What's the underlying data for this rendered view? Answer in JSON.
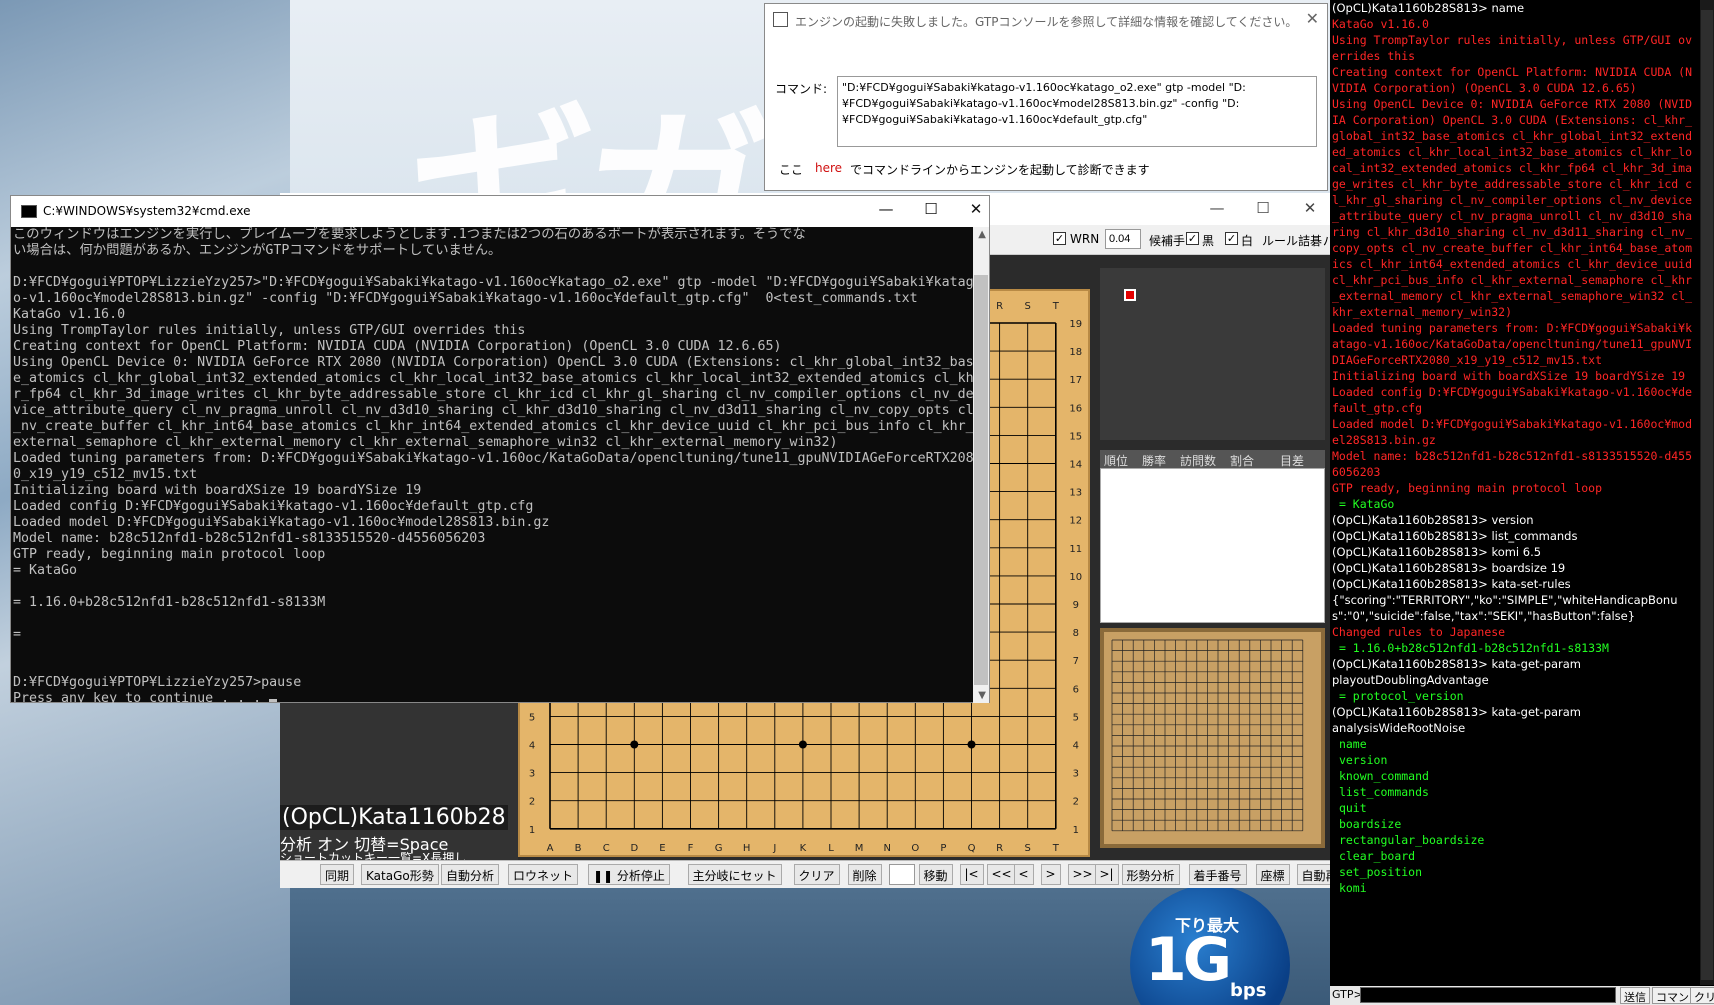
{
  "desktop": {
    "banner_text": "ギガ",
    "ad_small": "下り最大",
    "ad_big": "1G",
    "ad_unit": "bps"
  },
  "dialog": {
    "title": "エンジンの起動に失敗しました。GTPコンソールを参照して詳細な情報を確認してください。",
    "command_label": "コマンド:",
    "command_text": "\"D:¥FCD¥gogui¥Sabaki¥katago-v1.160oc¥katago_o2.exe\" gtp -model \"D:¥FCD¥gogui¥Sabaki¥katago-v1.160oc¥model28S813.bin.gz\" -config \"D:¥FCD¥gogui¥Sabaki¥katago-v1.160oc¥default_gtp.cfg\"",
    "footer_prefix": "ここ",
    "footer_link": "here",
    "footer_suffix": "でコマンドラインからエンジンを起動して診断できます"
  },
  "cmd": {
    "title": "C:¥WINDOWS¥system32¥cmd.exe",
    "lines": [
      "このウィンドウはエンジンを実行し、プレイムーブを要求しようとします.1つまたは2つの石のあるボートが表示されます。そうでな",
      "い場合は、何か問題があるか、エンジンがGTPコマンドをサポートしていません。",
      "",
      "D:¥FCD¥gogui¥PTOP¥LizzieYzy257>\"D:¥FCD¥gogui¥Sabaki¥katago-v1.160oc¥katago_o2.exe\" gtp -model \"D:¥FCD¥gogui¥Sabaki¥katag",
      "o-v1.160oc¥model28S813.bin.gz\" -config \"D:¥FCD¥gogui¥Sabaki¥katago-v1.160oc¥default_gtp.cfg\"  0<test_commands.txt",
      "KataGo v1.16.0",
      "Using TrompTaylor rules initially, unless GTP/GUI overrides this",
      "Creating context for OpenCL Platform: NVIDIA CUDA (NVIDIA Corporation) (OpenCL 3.0 CUDA 12.6.65)",
      "Using OpenCL Device 0: NVIDIA GeForce RTX 2080 (NVIDIA Corporation) OpenCL 3.0 CUDA (Extensions: cl_khr_global_int32_bas",
      "e_atomics cl_khr_global_int32_extended_atomics cl_khr_local_int32_base_atomics cl_khr_local_int32_extended_atomics cl_kh",
      "r_fp64 cl_khr_3d_image_writes cl_khr_byte_addressable_store cl_khr_icd cl_khr_gl_sharing cl_nv_compiler_options cl_nv_de",
      "vice_attribute_query cl_nv_pragma_unroll cl_nv_d3d10_sharing cl_khr_d3d10_sharing cl_nv_d3d11_sharing cl_nv_copy_opts cl",
      "_nv_create_buffer cl_khr_int64_base_atomics cl_khr_int64_extended_atomics cl_khr_device_uuid cl_khr_pci_bus_info cl_khr_",
      "external_semaphore cl_khr_external_memory cl_khr_external_semaphore_win32 cl_khr_external_memory_win32)",
      "Loaded tuning parameters from: D:¥FCD¥gogui¥Sabaki¥katago-v1.160oc/KataGoData/opencltuning/tune11_gpuNVIDIAGeForceRTX208",
      "0_x19_y19_c512_mv15.txt",
      "Initializing board with boardXSize 19 boardYSize 19",
      "Loaded config D:¥FCD¥gogui¥Sabaki¥katago-v1.160oc¥default_gtp.cfg",
      "Loaded model D:¥FCD¥gogui¥Sabaki¥katago-v1.160oc¥model28S813.bin.gz",
      "Model name: b28c512nfd1-b28c512nfd1-s8133515520-d4556056203",
      "GTP ready, beginning main protocol loop",
      "= KataGo",
      "",
      "= 1.16.0+b28c512nfd1-b28c512nfd1-s8133M",
      "",
      "=",
      "",
      "",
      "D:¥FCD¥gogui¥PTOP¥LizzieYzy257>pause",
      "Press any key to continue . . . "
    ]
  },
  "lizzie": {
    "menu": {
      "wrn_label": "WRN",
      "wrn_value": "0.04",
      "candidate_label": "候補手",
      "black_label": "黒",
      "white_label": "白",
      "rules_label": "ルール",
      "tsumego_label": "詰碁",
      "params_label": "パラメータ"
    },
    "status": {
      "engine": "(OpCL)Kata1160b28",
      "analysis": "分析 オン  切替=Space",
      "shortcut": "ショートカットキー一覧=X長押し"
    },
    "candidate_headers": [
      "順位",
      "勝率",
      "訪問数",
      "割合",
      "目差"
    ],
    "columns": [
      "A",
      "B",
      "C",
      "D",
      "E",
      "F",
      "G",
      "H",
      "J",
      "K",
      "L",
      "M",
      "N",
      "O",
      "P",
      "Q",
      "R",
      "S",
      "T"
    ],
    "rows": [
      "19",
      "18",
      "17",
      "16",
      "15",
      "14",
      "13",
      "12",
      "11",
      "10",
      "9",
      "8",
      "7",
      "6",
      "5",
      "4",
      "3",
      "2",
      "1"
    ],
    "toolbar": [
      "同期",
      "KataGo形勢",
      "自動分析",
      "ロウネット",
      "❚❚ 分析停止",
      "主分岐にセット",
      "クリア",
      "削除",
      "移動",
      "|<",
      "<<",
      "<",
      ">",
      ">>",
      ">|",
      "形勢分析",
      "着手番号",
      "座標",
      "自動再生"
    ]
  },
  "gtp": {
    "lines": [
      {
        "t": "cmd",
        "s": "(OpCL)Kata1160b28S813> name"
      },
      {
        "t": "err",
        "s": "KataGo v1.16.0"
      },
      {
        "t": "err",
        "s": "Using TrompTaylor rules initially, unless GTP/GUI overrides this"
      },
      {
        "t": "err",
        "s": "Creating context for OpenCL Platform: NVIDIA CUDA (NVIDIA Corporation) (OpenCL 3.0 CUDA 12.6.65)"
      },
      {
        "t": "err",
        "s": "Using OpenCL Device 0: NVIDIA GeForce RTX 2080 (NVIDIA Corporation) OpenCL 3.0 CUDA (Extensions: cl_khr_global_int32_base_atomics cl_khr_global_int32_extended_atomics cl_khr_local_int32_base_atomics cl_khr_local_int32_extended_atomics cl_khr_fp64 cl_khr_3d_image_writes cl_khr_byte_addressable_store cl_khr_icd cl_khr_gl_sharing cl_nv_compiler_options cl_nv_device_attribute_query cl_nv_pragma_unroll cl_nv_d3d10_sharing cl_khr_d3d10_sharing cl_nv_d3d11_sharing cl_nv_copy_opts cl_nv_create_buffer cl_khr_int64_base_atomics cl_khr_int64_extended_atomics cl_khr_device_uuid cl_khr_pci_bus_info cl_khr_external_semaphore cl_khr_external_memory cl_khr_external_semaphore_win32 cl_khr_external_memory_win32)"
      },
      {
        "t": "err",
        "s": "Loaded tuning parameters from: D:¥FCD¥gogui¥Sabaki¥katago-v1.160oc/KataGoData/opencltuning/tune11_gpuNVIDIAGeForceRTX2080_x19_y19_c512_mv15.txt"
      },
      {
        "t": "err",
        "s": "Initializing board with boardXSize 19 boardYSize 19"
      },
      {
        "t": "err",
        "s": "Loaded config D:¥FCD¥gogui¥Sabaki¥katago-v1.160oc¥default_gtp.cfg"
      },
      {
        "t": "err",
        "s": "Loaded model D:¥FCD¥gogui¥Sabaki¥katago-v1.160oc¥model28S813.bin.gz"
      },
      {
        "t": "err",
        "s": "Model name: b28c512nfd1-b28c512nfd1-s8133515520-d4556056203"
      },
      {
        "t": "err",
        "s": "GTP ready, beginning main protocol loop"
      },
      {
        "t": "ok",
        "s": " = KataGo"
      },
      {
        "t": "cmd",
        "s": "(OpCL)Kata1160b28S813> version"
      },
      {
        "t": "cmd",
        "s": "(OpCL)Kata1160b28S813> list_commands"
      },
      {
        "t": "cmd",
        "s": "(OpCL)Kata1160b28S813> komi 6.5"
      },
      {
        "t": "cmd",
        "s": "(OpCL)Kata1160b28S813> boardsize 19"
      },
      {
        "t": "cmd",
        "s": "(OpCL)Kata1160b28S813> kata-set-rules"
      },
      {
        "t": "resp",
        "s": "{\"scoring\":\"TERRITORY\",\"ko\":\"SIMPLE\",\"whiteHandicapBonus\":\"0\",\"suicide\":false,\"tax\":\"SEKI\",\"hasButton\":false}"
      },
      {
        "t": "err",
        "s": "Changed rules to Japanese"
      },
      {
        "t": "ok",
        "s": " = 1.16.0+b28c512nfd1-b28c512nfd1-s8133M"
      },
      {
        "t": "cmd",
        "s": "(OpCL)Kata1160b28S813> kata-get-param"
      },
      {
        "t": "resp",
        "s": "playoutDoublingAdvantage"
      },
      {
        "t": "ok",
        "s": " = protocol_version"
      },
      {
        "t": "cmd",
        "s": "(OpCL)Kata1160b28S813> kata-get-param"
      },
      {
        "t": "resp",
        "s": "analysisWideRootNoise"
      },
      {
        "t": "ok",
        "s": " name"
      },
      {
        "t": "ok",
        "s": " version"
      },
      {
        "t": "ok",
        "s": " known_command"
      },
      {
        "t": "ok",
        "s": " list_commands"
      },
      {
        "t": "ok",
        "s": " quit"
      },
      {
        "t": "ok",
        "s": " boardsize"
      },
      {
        "t": "ok",
        "s": " rectangular_boardsize"
      },
      {
        "t": "ok",
        "s": " clear_board"
      },
      {
        "t": "ok",
        "s": " set_position"
      },
      {
        "t": "ok",
        "s": " komi"
      }
    ],
    "prompt": "GTP>",
    "send_label": "送信",
    "command_label": "コマンド",
    "clear_label": "クリア"
  }
}
